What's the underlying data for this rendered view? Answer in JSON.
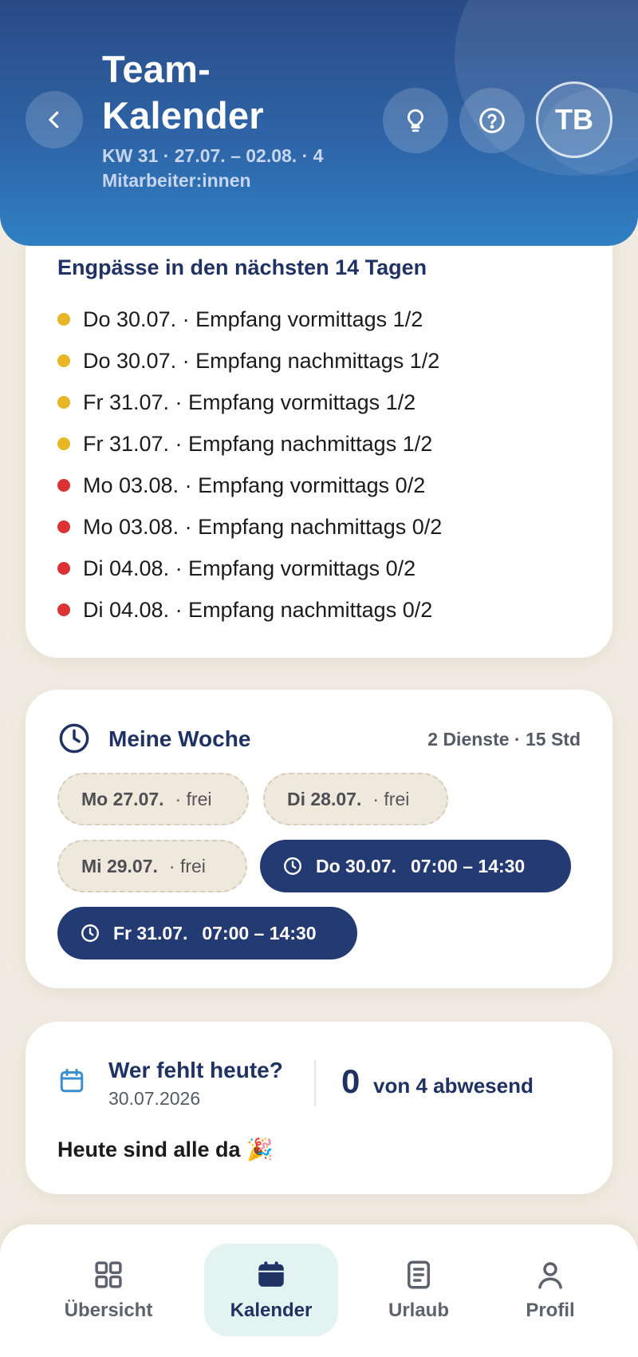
{
  "header": {
    "title": "Team-Kalender",
    "subtitle": "KW 31 · 27.07. – 02.08. · 4 Mitarbeiter:innen",
    "avatar_initials": "TB"
  },
  "shortages": {
    "title": "Engpässe in den nächsten 14 Tagen",
    "items": [
      {
        "text": "Do 30.07. · Empfang vormittags 1/2",
        "status": "warning"
      },
      {
        "text": "Do 30.07. · Empfang nachmittags 1/2",
        "status": "warning"
      },
      {
        "text": "Fr 31.07. · Empfang vormittags 1/2",
        "status": "warning"
      },
      {
        "text": "Fr 31.07. · Empfang nachmittags 1/2",
        "status": "warning"
      },
      {
        "text": "Mo 03.08. · Empfang vormittags 0/2",
        "status": "critical"
      },
      {
        "text": "Mo 03.08. · Empfang nachmittags 0/2",
        "status": "critical"
      },
      {
        "text": "Di 04.08. · Empfang vormittags 0/2",
        "status": "critical"
      },
      {
        "text": "Di 04.08. · Empfang nachmittags 0/2",
        "status": "critical"
      }
    ]
  },
  "week": {
    "title": "Meine Woche",
    "summary": "2 Dienste · 15 Std",
    "days": [
      {
        "day": "Mo 27.07.",
        "detail": "· frei",
        "type": "free"
      },
      {
        "day": "Di 28.07.",
        "detail": "· frei",
        "type": "free"
      },
      {
        "day": "Mi 29.07.",
        "detail": "· frei",
        "type": "free"
      },
      {
        "day": "Do 30.07.",
        "detail": "07:00 – 14:30",
        "type": "shift"
      },
      {
        "day": "Fr 31.07.",
        "detail": "07:00 – 14:30",
        "type": "shift"
      }
    ]
  },
  "absent": {
    "title": "Wer fehlt heute?",
    "date": "30.07.2026",
    "count": "0",
    "of_label": "von 4 abwesend",
    "message": "Heute sind alle da 🎉"
  },
  "nav": {
    "items": [
      {
        "label": "Übersicht",
        "icon": "grid-icon",
        "active": false
      },
      {
        "label": "Kalender",
        "icon": "calendar-icon",
        "active": true
      },
      {
        "label": "Urlaub",
        "icon": "document-icon",
        "active": false
      },
      {
        "label": "Profil",
        "icon": "user-icon",
        "active": false
      }
    ]
  },
  "colors": {
    "primary": "#243a72",
    "warning": "#e8b622",
    "critical": "#dc3232",
    "background": "#f1ece2",
    "nav_active_bg": "#e3f3f1"
  }
}
